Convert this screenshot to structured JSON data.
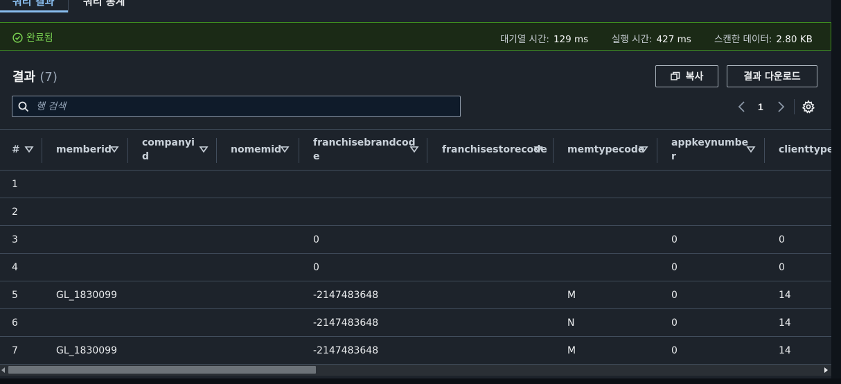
{
  "tabs": [
    {
      "label": "쿼리 결과",
      "active": true
    },
    {
      "label": "쿼리 통계",
      "active": false
    }
  ],
  "status": {
    "label": "완료됨",
    "queue_time_label": "대기열 시간:",
    "queue_time_value": "129 ms",
    "exec_time_label": "실행 시간:",
    "exec_time_value": "427 ms",
    "scanned_label": "스캔한 데이터:",
    "scanned_value": "2.80 KB"
  },
  "results": {
    "title": "결과",
    "count": "(7)"
  },
  "buttons": {
    "copy": "복사",
    "download": "결과 다운로드"
  },
  "search": {
    "placeholder": "행 검색"
  },
  "pager": {
    "current": "1"
  },
  "table": {
    "headers": [
      "#",
      "memberid",
      "companyi\nd",
      "nomemid",
      "franchisebrandcod\ne",
      "franchisestorecode",
      "memtypecode",
      "appkeynumbe\nr",
      "clienttype"
    ],
    "rows": [
      {
        "n": "1",
        "memberid": "",
        "franchisebrandcode": "",
        "memtypecode": "",
        "appkeynumber": "",
        "clienttype": ""
      },
      {
        "n": "2",
        "memberid": "",
        "franchisebrandcode": "",
        "memtypecode": "",
        "appkeynumber": "",
        "clienttype": ""
      },
      {
        "n": "3",
        "memberid": "",
        "franchisebrandcode": "0",
        "memtypecode": "",
        "appkeynumber": "0",
        "clienttype": "0"
      },
      {
        "n": "4",
        "memberid": "",
        "franchisebrandcode": "0",
        "memtypecode": "",
        "appkeynumber": "0",
        "clienttype": "0"
      },
      {
        "n": "5",
        "memberid": "GL_1830099",
        "franchisebrandcode": "-2147483648",
        "memtypecode": "M",
        "appkeynumber": "0",
        "clienttype": "14"
      },
      {
        "n": "6",
        "memberid": "",
        "franchisebrandcode": "-2147483648",
        "memtypecode": "N",
        "appkeynumber": "0",
        "clienttype": "14"
      },
      {
        "n": "7",
        "memberid": "GL_1830099",
        "franchisebrandcode": "-2147483648",
        "memtypecode": "M",
        "appkeynumber": "0",
        "clienttype": "14"
      }
    ]
  },
  "colors": {
    "success": "#7bd452",
    "accent": "#89bdee",
    "status_border": "#3e8e1f"
  }
}
